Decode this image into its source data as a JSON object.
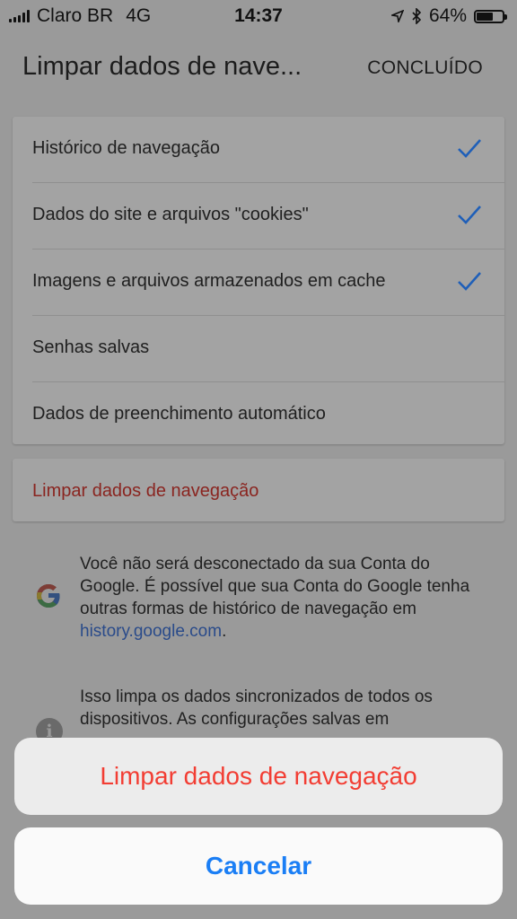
{
  "status_bar": {
    "carrier": "Claro BR",
    "network": "4G",
    "time": "14:37",
    "battery_percent": "64%",
    "battery_level": 0.64,
    "icons": [
      "signal-icon",
      "location-icon",
      "bluetooth-icon",
      "battery-icon"
    ]
  },
  "header": {
    "title": "Limpar dados de nave...",
    "done_label": "CONCLUÍDO"
  },
  "options": [
    {
      "label": "Histórico de navegação",
      "checked": true
    },
    {
      "label": "Dados do site e arquivos \"cookies\"",
      "checked": true
    },
    {
      "label": "Imagens e arquivos armazenados em cache",
      "checked": true
    },
    {
      "label": "Senhas salvas",
      "checked": false
    },
    {
      "label": "Dados de preenchimento automático",
      "checked": false
    }
  ],
  "clear_action": {
    "label": "Limpar dados de navegação"
  },
  "info_google": {
    "text_before": "Você não será desconectado da sua Conta do Google. É possível que sua Conta do Google tenha outras formas de histórico de navegação em ",
    "link": "history.google.com",
    "text_after": "."
  },
  "info_sync": {
    "icon_label": "i",
    "text": "Isso limpa os dados sincronizados de todos os dispositivos. As configurações salvas em"
  },
  "action_sheet": {
    "destructive_label": "Limpar dados de navegação",
    "cancel_label": "Cancelar"
  },
  "colors": {
    "check": "#1f5fb8",
    "destructive": "#f23d33",
    "cancel": "#1a7ef5",
    "link": "#2a4b8a"
  }
}
